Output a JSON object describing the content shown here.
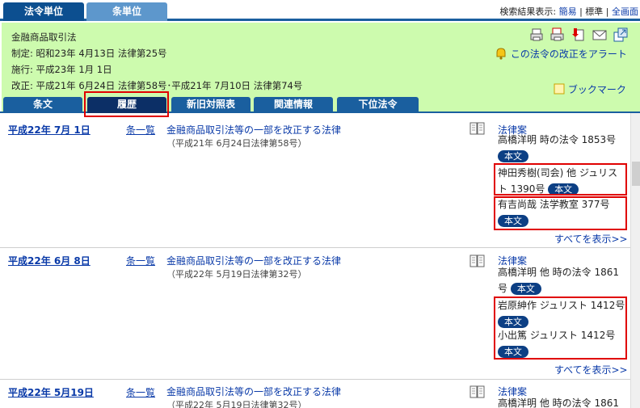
{
  "top_tabs": [
    "法令単位",
    "条単位"
  ],
  "display": {
    "label": "検索結果表示:",
    "simple": "簡易",
    "sep1": " | ",
    "standard": "標準",
    "sep2": " | ",
    "full": "全画面"
  },
  "header": {
    "title": "金融商品取引法",
    "enacted": "制定: 昭和23年 4月13日 法律第25号",
    "enforced": "施行: 平成23年 1月 1日",
    "amended": "改正: 平成21年 6月24日 法律第58号･平成21年 7月10日 法律第74号",
    "alert": "この法令の改正をアラート",
    "bookmark": "ブックマーク"
  },
  "tabs": [
    "条文",
    "履歴",
    "新旧対照表",
    "関連情報",
    "下位法令"
  ],
  "rows": [
    {
      "date": "平成22年 7月 1日",
      "list": "条一覧",
      "law": "金融商品取引法等の一部を改正する法律",
      "sub": "（平成21年 6月24日法律第58号）",
      "ref_head": "法律案",
      "refs": [
        {
          "text": "高橋洋明 時の法令 1853号",
          "btn": "本文"
        },
        {
          "text": "神田秀樹(司会) 他 ジュリスト 1390号",
          "btn": "本文"
        },
        {
          "text": "有吉尚哉 法学教室 377号",
          "btn": "本文"
        }
      ],
      "show_all": "すべてを表示>>"
    },
    {
      "date": "平成22年 6月 8日",
      "list": "条一覧",
      "law": "金融商品取引法等の一部を改正する法律",
      "sub": "（平成22年 5月19日法律第32号）",
      "ref_head": "法律案",
      "refs": [
        {
          "text": "高橋洋明 他 時の法令 1861号",
          "btn": "本文"
        },
        {
          "text": "岩原紳作 ジュリスト 1412号",
          "btn": "本文"
        },
        {
          "text": "小出篤 ジュリスト 1412号",
          "btn": "本文"
        }
      ],
      "show_all": "すべてを表示>>"
    },
    {
      "date": "平成22年 5月19日",
      "list": "条一覧",
      "law": "金融商品取引法等の一部を改正する法律",
      "sub": "（平成22年 5月19日法律第32号）",
      "ref_head": "法律案",
      "refs": [
        {
          "text": "高橋洋明 他 時の法令 1861"
        }
      ]
    }
  ]
}
